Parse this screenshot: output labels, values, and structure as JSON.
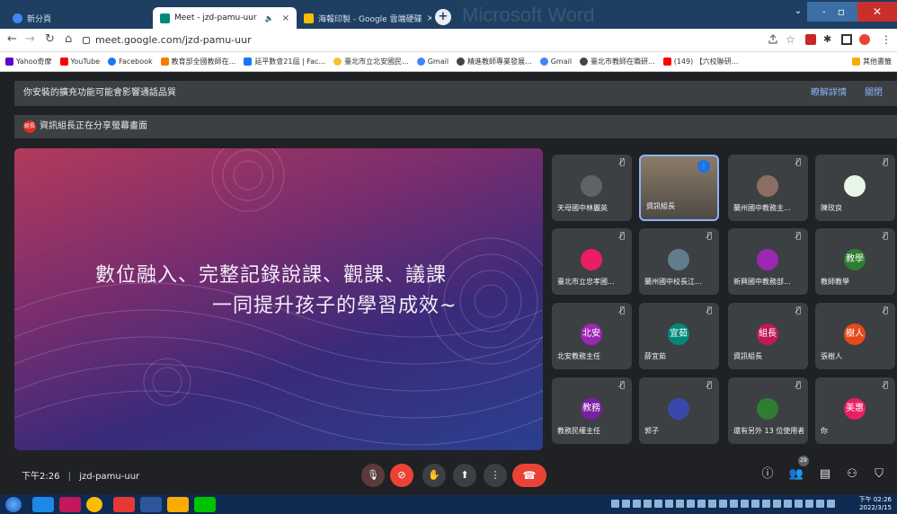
{
  "browser": {
    "tabs": [
      {
        "label": "新分頁",
        "close": "×",
        "color": "#4285f4"
      },
      {
        "label": "Meet - jzd-pamu-uur",
        "close": "×",
        "color": "#00897b"
      },
      {
        "label": "海報印製 - Google 雲端硬碟",
        "close": "×",
        "color": "#fbbc04"
      }
    ],
    "new_tab": "+",
    "background_window_title": "Microsoft Word",
    "url": "meet.google.com/jzd-pamu-uur",
    "bookmarks": [
      {
        "label": "Yahoo奇摩",
        "color": "#6001d2"
      },
      {
        "label": "YouTube",
        "color": "#ff0000"
      },
      {
        "label": "Facebook",
        "color": "#1877f2"
      },
      {
        "label": "教育部全國教師在...",
        "color": "#f57c00"
      },
      {
        "label": "延平數會21屆 | Fac...",
        "color": "#1877f2"
      },
      {
        "label": "臺北市立北安國民...",
        "color": "#fbc02d"
      },
      {
        "label": "Gmail",
        "color": "#4285f4"
      },
      {
        "label": "精進教師專業發展...",
        "color": "#444444"
      },
      {
        "label": "Gmail",
        "color": "#4285f4"
      },
      {
        "label": "臺北市教師在職研...",
        "color": "#444444"
      },
      {
        "label": "(149) 【六校聯研...",
        "color": "#ff0000"
      }
    ],
    "other_bookmarks": "其他書籤"
  },
  "meet": {
    "notice": {
      "text": "你安裝的擴充功能可能會影響通話品質",
      "learn_more": "瞭解詳情",
      "close": "關閉"
    },
    "sharing": {
      "avatar": "組長",
      "text": "資訊組長正在分享螢幕畫面"
    },
    "slide": {
      "line1": "數位融入、完整記錄說課、觀課、議課",
      "line2": "一同提升孩子的學習成效~"
    },
    "participants": [
      {
        "name": "天母國中林麗英",
        "avatar": "",
        "color": "#5f6368",
        "photo": true
      },
      {
        "name": "資訊組長",
        "avatar": "",
        "color": "#5f6368",
        "photo": true,
        "speaking": true
      },
      {
        "name": "蘭州國中教務主...",
        "avatar": "",
        "color": "#8d6e63",
        "photo": true
      },
      {
        "name": "陳玫良",
        "avatar": "",
        "color": "#e8f5e9",
        "photo": true
      },
      {
        "name": "臺北市立忠孝國...",
        "avatar": "",
        "color": "#e91e63"
      },
      {
        "name": "蘭州國中校長江...",
        "avatar": "",
        "color": "#607d8b",
        "photo": true
      },
      {
        "name": "新興國中教務部...",
        "avatar": "",
        "color": "#9c27b0"
      },
      {
        "name": "教師教學",
        "avatar": "教學",
        "color": "#2e7d32"
      },
      {
        "name": "北安教務主任",
        "avatar": "北安",
        "color": "#9c27b0"
      },
      {
        "name": "薛宜茹",
        "avatar": "宜茹",
        "color": "#00897b"
      },
      {
        "name": "資訊組長",
        "avatar": "組長",
        "color": "#c2185b"
      },
      {
        "name": "張樹人",
        "avatar": "樹人",
        "color": "#e64a19"
      },
      {
        "name": "教務民權主任",
        "avatar": "教務",
        "color": "#7b1fa2"
      },
      {
        "name": "郭子",
        "avatar": "",
        "color": "#3949ab",
        "photo": true
      },
      {
        "name": "還有另外 13 位使用者",
        "avatar": "",
        "color": "#2e7d32"
      },
      {
        "name": "你",
        "avatar": "美惠",
        "color": "#e91e63"
      }
    ],
    "bottom": {
      "time": "下午2:26",
      "separator": "|",
      "meeting_code": "jzd-pamu-uur",
      "participant_count": "29"
    }
  },
  "taskbar": {
    "clock_time": "下午 02:26",
    "clock_date": "2022/3/15"
  },
  "colors": {
    "accent": "#8ab4f8",
    "danger": "#ea4335",
    "surface": "#3c4043",
    "background": "#202124"
  }
}
